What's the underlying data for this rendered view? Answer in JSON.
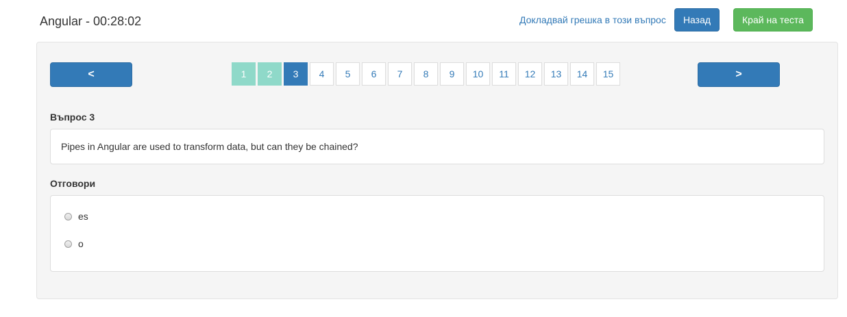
{
  "header": {
    "title": "Angular - 00:28:02",
    "report_link": "Докладвай грешка в този въпрос",
    "back_button": "Назад",
    "finish_button": "Край на теста"
  },
  "navigation": {
    "prev_label": "<",
    "next_label": ">",
    "pages": [
      {
        "label": "1",
        "state": "answered"
      },
      {
        "label": "2",
        "state": "answered"
      },
      {
        "label": "3",
        "state": "current"
      },
      {
        "label": "4",
        "state": "default"
      },
      {
        "label": "5",
        "state": "default"
      },
      {
        "label": "6",
        "state": "default"
      },
      {
        "label": "7",
        "state": "default"
      },
      {
        "label": "8",
        "state": "default"
      },
      {
        "label": "9",
        "state": "default"
      },
      {
        "label": "10",
        "state": "default"
      },
      {
        "label": "11",
        "state": "default"
      },
      {
        "label": "12",
        "state": "default"
      },
      {
        "label": "13",
        "state": "default"
      },
      {
        "label": "14",
        "state": "default"
      },
      {
        "label": "15",
        "state": "default"
      }
    ]
  },
  "question": {
    "heading": "Въпрос 3",
    "text": "Pipes in Angular are used to transform data, but can they be chained?"
  },
  "answers": {
    "heading": "Отговори",
    "options": [
      {
        "label": "es",
        "selected": false
      },
      {
        "label": "o",
        "selected": false
      }
    ]
  },
  "colors": {
    "primary": "#337ab7",
    "success": "#5cb85c",
    "answered": "#8fd9c9"
  }
}
